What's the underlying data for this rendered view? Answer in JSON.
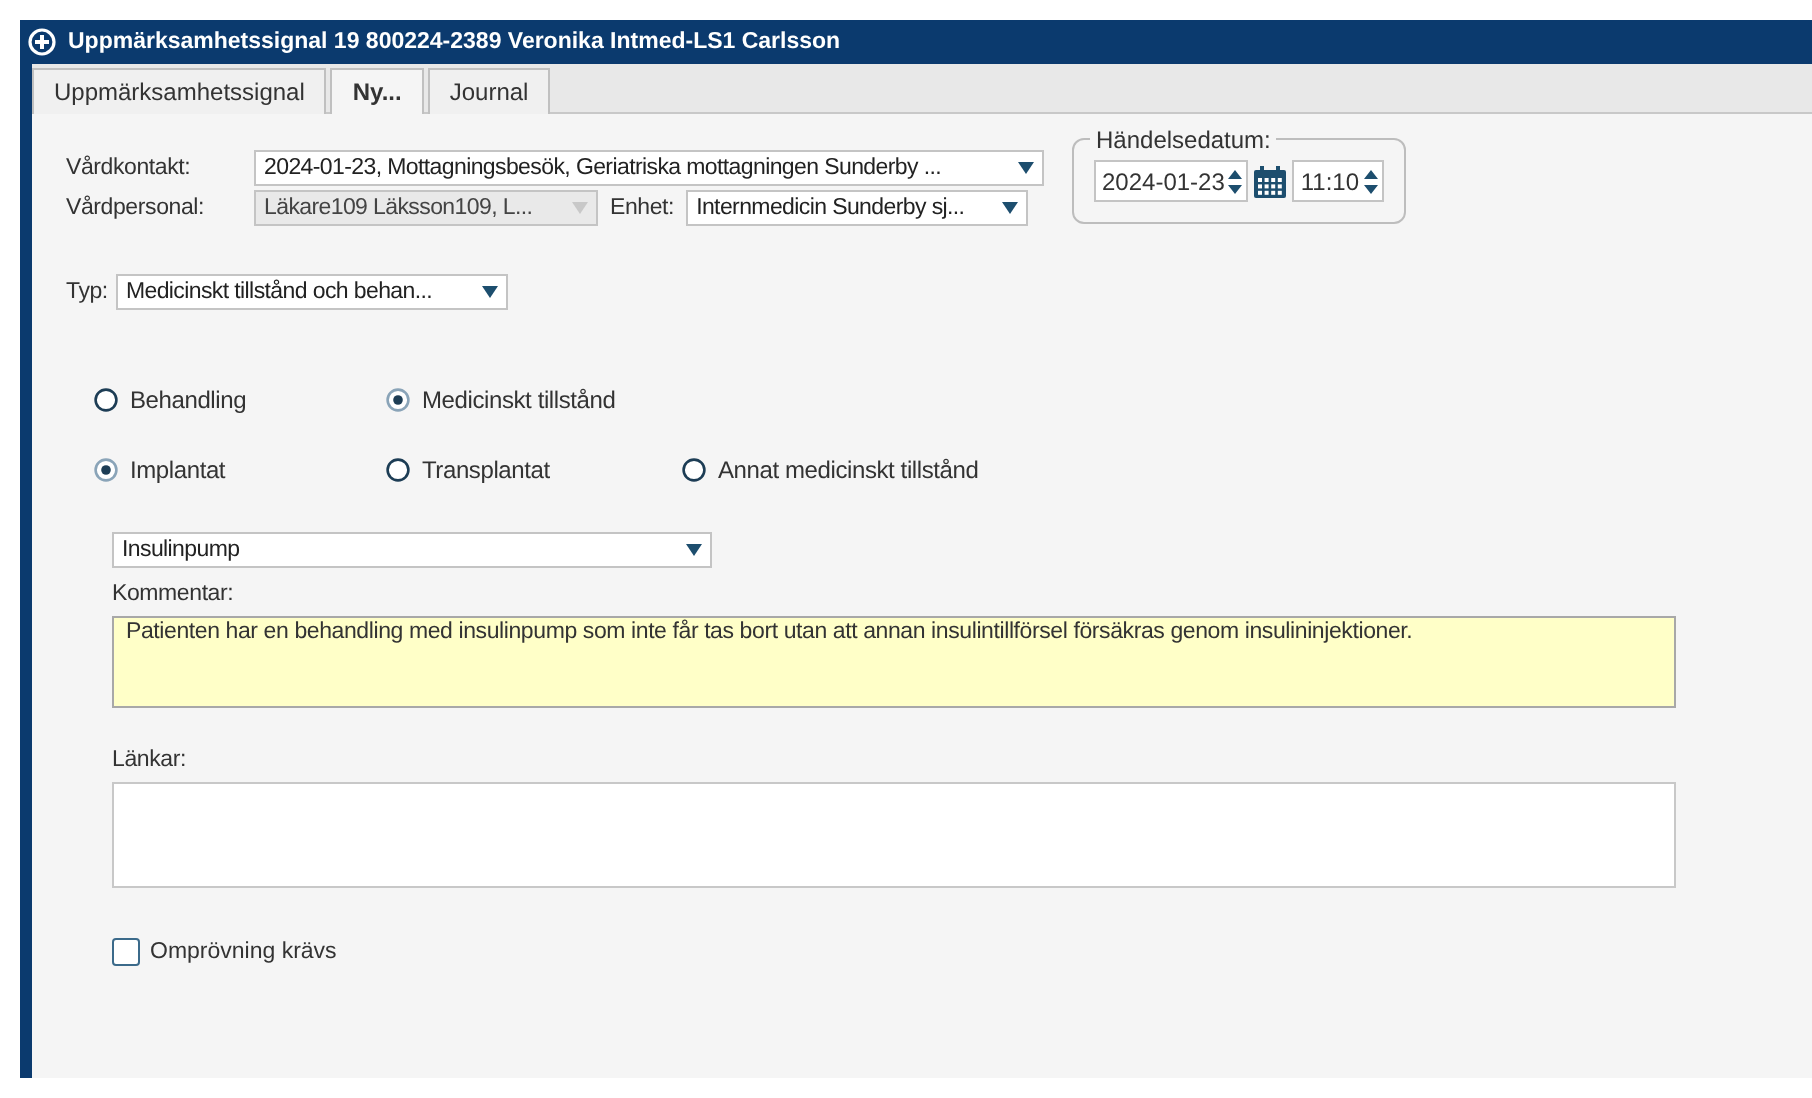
{
  "window": {
    "title": "Uppmärksamhetssignal 19 800224-2389 Veronika Intmed-LS1 Carlsson"
  },
  "tabs": [
    {
      "label": "Uppmärksamhetssignal",
      "selected": false
    },
    {
      "label": "Ny...",
      "selected": true
    },
    {
      "label": "Journal",
      "selected": false
    }
  ],
  "vardkontakt": {
    "label": "Vårdkontakt:",
    "value": "2024-01-23, Mottagningsbesök, Geriatriska mottagningen Sunderby ..."
  },
  "vardpersonal": {
    "label": "Vårdpersonal:",
    "value": "Läkare109 Läksson109, L...",
    "disabled": true
  },
  "enhet": {
    "label": "Enhet:",
    "value": "Internmedicin Sunderby sj...",
    "disabled": false
  },
  "handelsedatum": {
    "label": "Händelsedatum:",
    "date": "2024-01-23",
    "time": "11:10"
  },
  "typ": {
    "label": "Typ:",
    "value": "Medicinskt tillstånd och behan..."
  },
  "radio_rows": [
    {
      "options": [
        {
          "label": "Behandling",
          "selected": false
        },
        {
          "label": "Medicinskt tillstånd",
          "selected": true
        }
      ]
    },
    {
      "options": [
        {
          "label": "Implantat",
          "selected": true
        },
        {
          "label": "Transplantat",
          "selected": false
        },
        {
          "label": "Annat medicinskt tillstånd",
          "selected": false
        }
      ]
    }
  ],
  "implant_select": {
    "value": "Insulinpump"
  },
  "kommentar": {
    "label": "Kommentar:",
    "value": "Patienten har en behandling med insulinpump som inte får tas bort utan att annan insulintillförsel försäkras genom insulininjektioner."
  },
  "lankar": {
    "label": "Länkar:"
  },
  "omprovning": {
    "label": "Omprövning krävs",
    "checked": false
  }
}
